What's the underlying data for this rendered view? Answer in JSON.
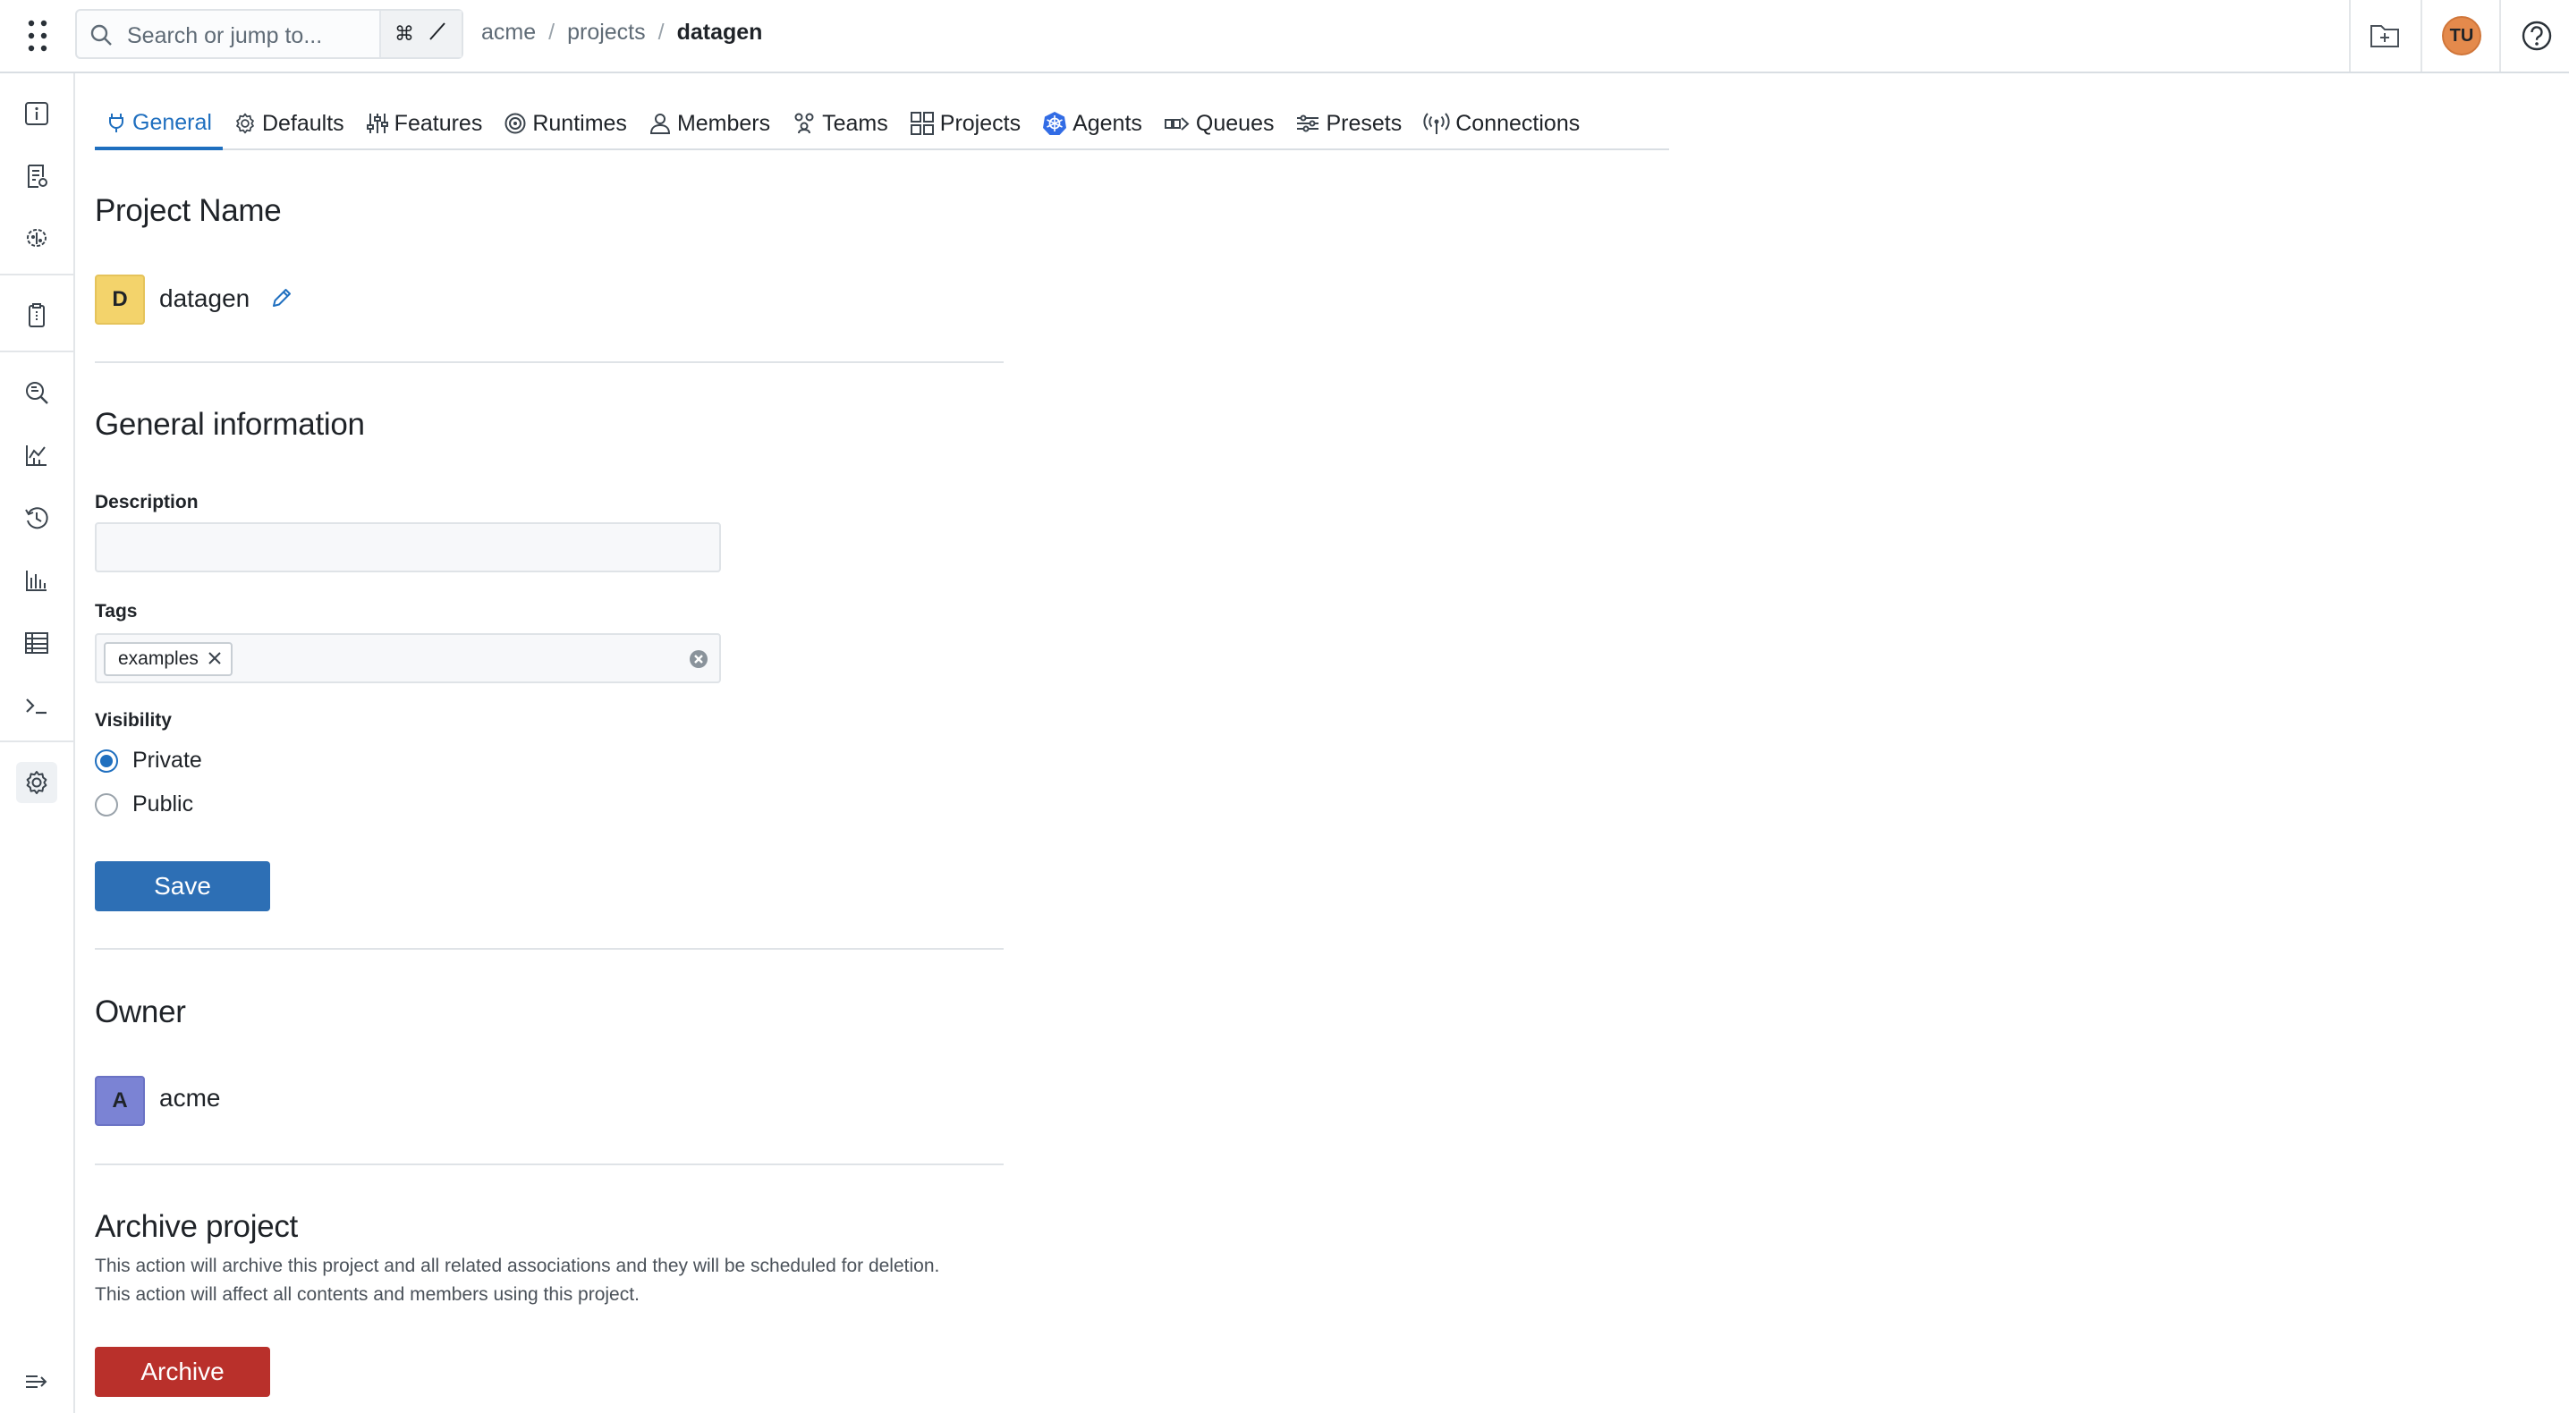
{
  "topbar": {
    "search_placeholder": "Search or jump to...",
    "shortcut_cmd": "⌘",
    "shortcut_slash": "/",
    "breadcrumbs": [
      "acme",
      "projects",
      "datagen"
    ],
    "breadcrumb_separator": "/",
    "user_initials": "TU"
  },
  "tabs": [
    {
      "label": "General",
      "icon": "plug-icon",
      "active": true
    },
    {
      "label": "Defaults",
      "icon": "gear-icon"
    },
    {
      "label": "Features",
      "icon": "sliders-icon"
    },
    {
      "label": "Runtimes",
      "icon": "target-icon"
    },
    {
      "label": "Members",
      "icon": "person-icon"
    },
    {
      "label": "Teams",
      "icon": "team-icon"
    },
    {
      "label": "Projects",
      "icon": "grid-icon"
    },
    {
      "label": "Agents",
      "icon": "kubernetes-icon"
    },
    {
      "label": "Queues",
      "icon": "queue-icon"
    },
    {
      "label": "Presets",
      "icon": "presets-icon"
    },
    {
      "label": "Connections",
      "icon": "broadcast-icon"
    }
  ],
  "project_name": {
    "heading": "Project Name",
    "initial": "D",
    "name": "datagen"
  },
  "general_info": {
    "heading": "General information",
    "description_label": "Description",
    "description_value": "",
    "tags_label": "Tags",
    "tags": [
      "examples"
    ],
    "visibility_label": "Visibility",
    "visibility_options": [
      "Private",
      "Public"
    ],
    "visibility_selected": "Private",
    "save_label": "Save"
  },
  "owner": {
    "heading": "Owner",
    "initial": "A",
    "name": "acme"
  },
  "archive": {
    "heading": "Archive project",
    "line1": "This action will archive this project and all related associations and they will be scheduled for deletion.",
    "line2": "This action will affect all contents and members using this project.",
    "button_label": "Archive"
  },
  "colors": {
    "accent": "#1f6fbf",
    "save": "#2d6fb5",
    "archive": "#b9302b",
    "project_avatar": "#f3d36b",
    "owner_avatar": "#7b83d4",
    "user_avatar": "#e48a4c"
  }
}
